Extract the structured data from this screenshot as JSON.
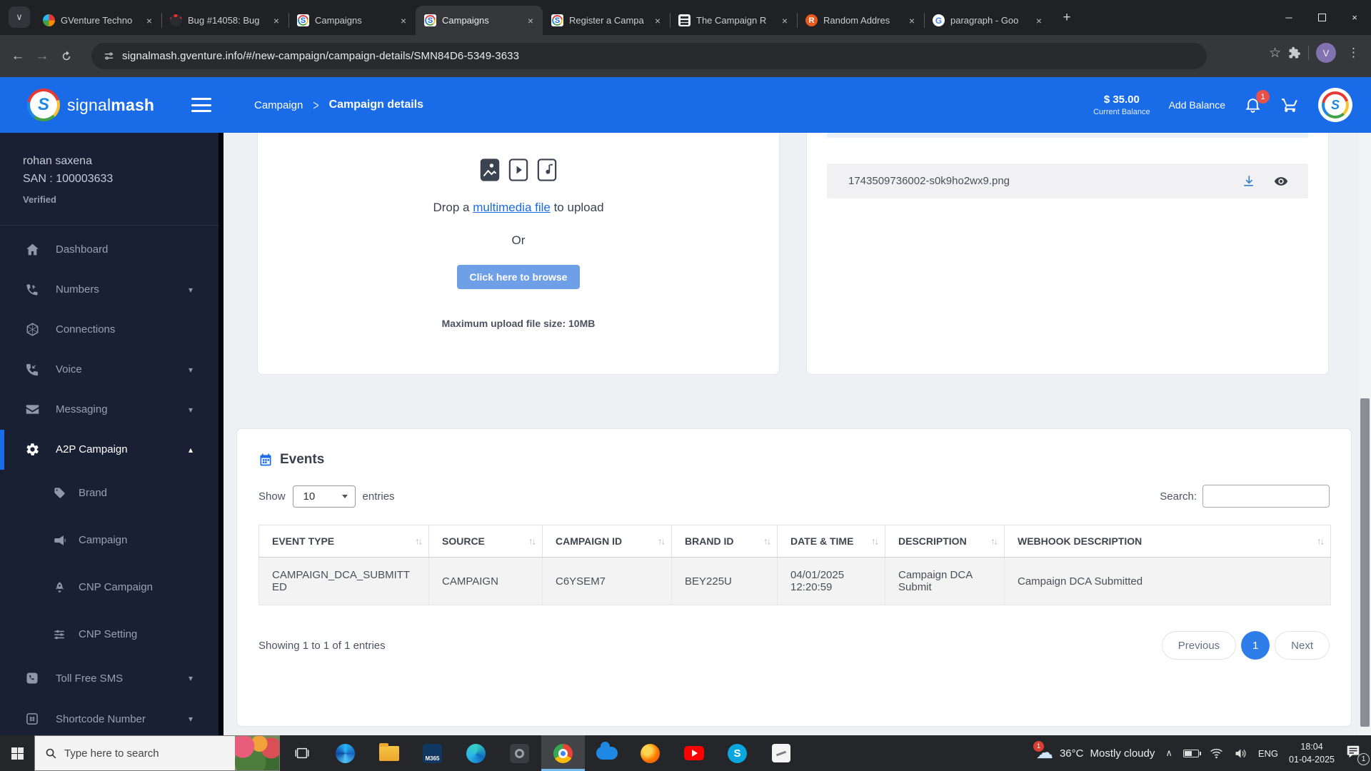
{
  "icons": {
    "close": "×",
    "minimize": "─",
    "back": "←",
    "forward": "→",
    "kebab": "⋮",
    "star": "☆",
    "tab_search_chevron": "∨",
    "chevron_down": "▾",
    "chevron_up": "▴",
    "sort": "↑↓",
    "breadcrumb_sep": ">",
    "plus": "+",
    "tray_chevron": "∧",
    "cloud": "☁"
  },
  "browser": {
    "tabs": [
      {
        "title": "GVenture Techno"
      },
      {
        "title": "Bug #14058: Bug"
      },
      {
        "title": "Campaigns"
      },
      {
        "title": "Campaigns"
      },
      {
        "title": "Register a Campa"
      },
      {
        "title": "The Campaign R"
      },
      {
        "title": "Random Addres"
      },
      {
        "title": "paragraph - Goo"
      }
    ],
    "rand_letter": "R",
    "google_letter": "G",
    "url": "signalmash.gventure.info/#/new-campaign/campaign-details/SMN84D6-5349-3633",
    "profile_initial": "V"
  },
  "header": {
    "brand_light": "signal",
    "brand_bold": "mash",
    "logo_letter": "S",
    "breadcrumb_parent": "Campaign",
    "breadcrumb_current": "Campaign details",
    "balance_amount": "$ 35.00",
    "balance_label": "Current Balance",
    "add_balance": "Add Balance",
    "notification_count": "1"
  },
  "sidebar": {
    "user": {
      "name": "rohan saxena",
      "san": "SAN : 100003633",
      "status": "Verified"
    },
    "items": [
      {
        "label": "Dashboard"
      },
      {
        "label": "Numbers"
      },
      {
        "label": "Connections"
      },
      {
        "label": "Voice"
      },
      {
        "label": "Messaging"
      },
      {
        "label": "A2P Campaign"
      },
      {
        "label": "Brand"
      },
      {
        "label": "Campaign"
      },
      {
        "label": "CNP Campaign"
      },
      {
        "label": "CNP Setting"
      },
      {
        "label": "Toll Free SMS"
      },
      {
        "label": "Shortcode Number"
      }
    ]
  },
  "content": {
    "upload": {
      "drop_pre": "Drop a ",
      "drop_link": "multimedia file",
      "drop_post": " to upload",
      "or": "Or",
      "browse_button": "Click here to browse",
      "max_size": "Maximum upload file size: 10MB"
    },
    "files": {
      "file_name": "1743509736002-s0k9ho2wx9.png"
    },
    "events": {
      "title": "Events",
      "show_label": "Show",
      "page_size": "10",
      "entries_label": "entries",
      "search_label": "Search:",
      "columns": [
        "EVENT TYPE",
        "SOURCE",
        "CAMPAIGN ID",
        "BRAND ID",
        "DATE & TIME",
        "DESCRIPTION",
        "WEBHOOK DESCRIPTION"
      ],
      "row": {
        "event_type": "CAMPAIGN_DCA_SUBMITTED",
        "source": "CAMPAIGN",
        "campaign_id": "C6YSEM7",
        "brand_id": "BEY225U",
        "datetime": "04/01/2025 12:20:59",
        "description": "Campaign DCA Submit",
        "webhook_description": "Campaign DCA Submitted"
      },
      "footer": "Showing 1 to 1 of 1 entries",
      "prev": "Previous",
      "page": "1",
      "next": "Next"
    }
  },
  "taskbar": {
    "search_placeholder": "Type here to search",
    "m365_label": "M365",
    "skype_letter": "S",
    "weather_badge": "1",
    "weather_temp": "36°C",
    "weather_desc": "Mostly cloudy",
    "language": "ENG",
    "time": "18:04",
    "date": "01-04-2025",
    "action_badge": "1"
  }
}
